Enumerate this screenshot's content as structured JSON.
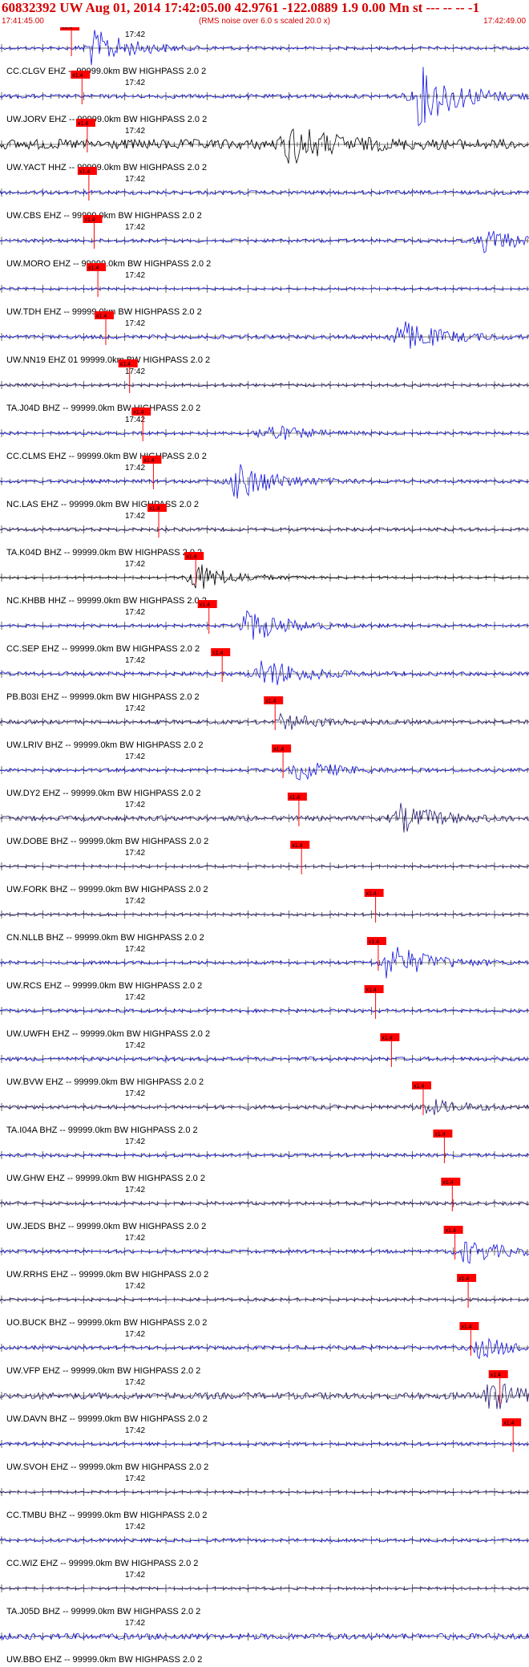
{
  "header": {
    "title": "60832392 UW Aug 01, 2014 17:42:05.00   42.9761 -122.0889  1.9 0.00 Mn st --- -- --   -1",
    "subtitle": "(RMS noise over 6.0 s scaled 20.0 x)",
    "time_start": "17:41:45.00",
    "time_end": "17:42:49.00"
  },
  "minute_label": "17:42",
  "pick_label": "x1.4",
  "colors": {
    "header": "#d40000",
    "pick": "#ff0000",
    "blue": "#1010e0",
    "navy": "#201870",
    "black": "#000000",
    "axis": "#000000"
  },
  "traces": [
    {
      "label": "CC.CLGV EHZ -- 99999.0km BW  HIGHPASS  2.0  2",
      "pick": 0.135,
      "color": "blue",
      "amp": 0.25,
      "burst": 0.18,
      "burstAmp": 2.2
    },
    {
      "label": "UW.JORV EHZ -- 99999.0km BW  HIGHPASS  2.0  2",
      "pick": 0.155,
      "color": "blue",
      "amp": 0.35,
      "burst": 0.8,
      "burstAmp": 3.5
    },
    {
      "label": "UW.YACT HHZ -- 99999.0km BW  HIGHPASS  2.0  2",
      "pick": 0.165,
      "color": "black",
      "amp": 0.9,
      "burst": 0.55,
      "burstAmp": 2.2
    },
    {
      "label": "UW.CBS EHZ -- 99999.0km BW  HIGHPASS  2.0  2",
      "pick": 0.168,
      "color": "blue",
      "amp": 0.35,
      "burst": -1,
      "burstAmp": 0
    },
    {
      "label": "UW.MORO EHZ -- 99999.0km BW  HIGHPASS  2.0  2",
      "pick": 0.178,
      "color": "blue",
      "amp": 0.3,
      "burst": 0.92,
      "burstAmp": 1.4
    },
    {
      "label": "UW.TDH EHZ -- 99999.0km BW  HIGHPASS  2.0  2",
      "pick": 0.185,
      "color": "blue",
      "amp": 0.2,
      "burst": -1,
      "burstAmp": 0
    },
    {
      "label": "UW.NN19 EHZ 01 99999.0km BW  HIGHPASS  2.0  2",
      "pick": 0.2,
      "color": "blue",
      "amp": 0.35,
      "burst": 0.76,
      "burstAmp": 2.0
    },
    {
      "label": "TA.J04D BHZ -- 99999.0km BW  HIGHPASS  2.0  2",
      "pick": 0.245,
      "color": "navy",
      "amp": 0.25,
      "burst": -1,
      "burstAmp": 0
    },
    {
      "label": "CC.CLMS EHZ -- 99999.0km BW  HIGHPASS  2.0  2",
      "pick": 0.27,
      "color": "blue",
      "amp": 0.25,
      "burst": 0.5,
      "burstAmp": 1.2
    },
    {
      "label": "NC.LAS EHZ -- 99999.0km BW  HIGHPASS  2.0  2",
      "pick": 0.29,
      "color": "blue",
      "amp": 0.3,
      "burst": 0.45,
      "burstAmp": 2.2
    },
    {
      "label": "TA.K04D BHZ -- 99999.0km BW  HIGHPASS  2.0  2",
      "pick": 0.3,
      "color": "navy",
      "amp": 0.3,
      "burst": -1,
      "burstAmp": 0
    },
    {
      "label": "NC.KHBB HHZ -- 99999.0km BW  HIGHPASS  2.0  2",
      "pick": 0.37,
      "color": "black",
      "amp": 0.15,
      "burst": 0.37,
      "burstAmp": 1.8
    },
    {
      "label": "CC.SEP EHZ -- 99999.0km BW  HIGHPASS  2.0  2",
      "pick": 0.395,
      "color": "blue",
      "amp": 0.25,
      "burst": 0.47,
      "burstAmp": 2.0
    },
    {
      "label": "PB.B03I EHZ -- 99999.0km BW  HIGHPASS  2.0  2",
      "pick": 0.42,
      "color": "blue",
      "amp": 0.35,
      "burst": 0.5,
      "burstAmp": 1.8
    },
    {
      "label": "UW.LRIV BHZ -- 99999.0km BW  HIGHPASS  2.0  2",
      "pick": 0.52,
      "color": "navy",
      "amp": 0.35,
      "burst": 0.54,
      "burstAmp": 0.9
    },
    {
      "label": "UW.DY2 EHZ -- 99999.0km BW  HIGHPASS  2.0  2",
      "pick": 0.535,
      "color": "blue",
      "amp": 0.3,
      "burst": 0.57,
      "burstAmp": 1.2
    },
    {
      "label": "UW.DOBE BHZ -- 99999.0km BW  HIGHPASS  2.0  2",
      "pick": 0.565,
      "color": "navy",
      "amp": 0.45,
      "burst": 0.76,
      "burstAmp": 1.6
    },
    {
      "label": "UW.FORK BHZ -- 99999.0km BW  HIGHPASS  2.0  2",
      "pick": 0.57,
      "color": "navy",
      "amp": 0.2,
      "burst": -1,
      "burstAmp": 0
    },
    {
      "label": "CN.NLLB BHZ -- 99999.0km BW  HIGHPASS  2.0  2",
      "pick": 0.71,
      "color": "navy",
      "amp": 0.2,
      "burst": -1,
      "burstAmp": 0
    },
    {
      "label": "UW.RCS EHZ -- 99999.0km BW  HIGHPASS  2.0  2",
      "pick": 0.715,
      "color": "blue",
      "amp": 0.3,
      "burst": 0.74,
      "burstAmp": 2.2
    },
    {
      "label": "UW.UWFH EHZ -- 99999.0km BW  HIGHPASS  2.0  2",
      "pick": 0.71,
      "color": "blue",
      "amp": 0.3,
      "burst": -1,
      "burstAmp": 0
    },
    {
      "label": "UW.BVW EHZ -- 99999.0km BW  HIGHPASS  2.0  2",
      "pick": 0.74,
      "color": "blue",
      "amp": 0.35,
      "burst": -1,
      "burstAmp": 0
    },
    {
      "label": "TA.I04A BHZ -- 99999.0km BW  HIGHPASS  2.0  2",
      "pick": 0.8,
      "color": "navy",
      "amp": 0.35,
      "burst": 0.81,
      "burstAmp": 0.9
    },
    {
      "label": "UW.GHW EHZ -- 99999.0km BW  HIGHPASS  2.0  2",
      "pick": 0.84,
      "color": "blue",
      "amp": 0.3,
      "burst": -1,
      "burstAmp": 0
    },
    {
      "label": "UW.JEDS BHZ -- 99999.0km BW  HIGHPASS  2.0  2",
      "pick": 0.855,
      "color": "navy",
      "amp": 0.3,
      "burst": -1,
      "burstAmp": 0
    },
    {
      "label": "UW.RRHS EHZ -- 99999.0km BW  HIGHPASS  2.0  2",
      "pick": 0.86,
      "color": "blue",
      "amp": 0.3,
      "burst": 0.885,
      "burstAmp": 1.4
    },
    {
      "label": "UO.BUCK BHZ -- 99999.0km BW  HIGHPASS  2.0  2",
      "pick": 0.885,
      "color": "navy",
      "amp": 0.25,
      "burst": -1,
      "burstAmp": 0
    },
    {
      "label": "UW.VFP EHZ -- 99999.0km BW  HIGHPASS  2.0  2",
      "pick": 0.89,
      "color": "blue",
      "amp": 0.35,
      "burst": 0.91,
      "burstAmp": 1.2
    },
    {
      "label": "UW.DAVN BHZ -- 99999.0km BW  HIGHPASS  2.0  2",
      "pick": 0.945,
      "color": "navy",
      "amp": 0.6,
      "burst": 0.93,
      "burstAmp": 1.6
    },
    {
      "label": "UW.SVOH EHZ -- 99999.0km BW  HIGHPASS  2.0  2",
      "pick": 0.97,
      "color": "blue",
      "amp": 0.3,
      "burst": -1,
      "burstAmp": 0
    },
    {
      "label": "CC.TMBU BHZ -- 99999.0km BW  HIGHPASS  2.0  2",
      "pick": -1,
      "color": "navy",
      "amp": 0.2,
      "burst": -1,
      "burstAmp": 0
    },
    {
      "label": "CC.WIZ EHZ -- 99999.0km BW  HIGHPASS  2.0  2",
      "pick": -1,
      "color": "blue",
      "amp": 0.3,
      "burst": -1,
      "burstAmp": 0
    },
    {
      "label": "TA.J05D BHZ -- 99999.0km BW  HIGHPASS  2.0  2",
      "pick": -1,
      "color": "navy",
      "amp": 0.2,
      "burst": -1,
      "burstAmp": 0
    },
    {
      "label": "UW.BBO EHZ -- 99999.0km BW  HIGHPASS  2.0  2",
      "pick": -1,
      "color": "blue",
      "amp": 0.55,
      "burst": -1,
      "burstAmp": 0
    }
  ]
}
